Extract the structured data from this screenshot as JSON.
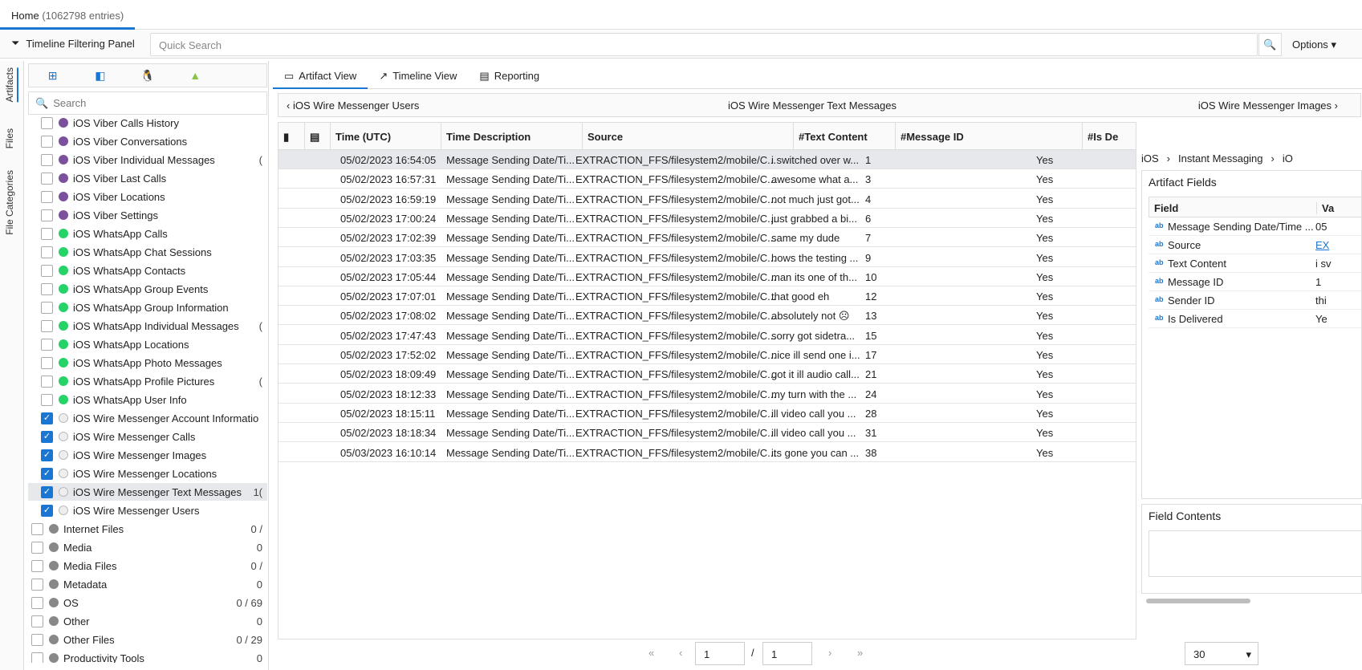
{
  "home": {
    "title": "Home",
    "count": "(1062798 entries)"
  },
  "filterbar": {
    "label": "Timeline Filtering Panel",
    "search_placeholder": "Quick Search",
    "options": "Options"
  },
  "vtabs": {
    "artifacts": "Artifacts",
    "files": "Files",
    "categories": "File Categories"
  },
  "sidebar": {
    "search": "Search",
    "items": [
      {
        "label": "iOS Viber Calls History",
        "icon": "viber",
        "checked": false,
        "sub": true
      },
      {
        "label": "iOS Viber Conversations",
        "icon": "viber",
        "checked": false,
        "sub": true
      },
      {
        "label": "iOS Viber Individual Messages",
        "icon": "viber",
        "checked": false,
        "sub": true,
        "count": "("
      },
      {
        "label": "iOS Viber Last Calls",
        "icon": "viber",
        "checked": false,
        "sub": true
      },
      {
        "label": "iOS Viber Locations",
        "icon": "viber",
        "checked": false,
        "sub": true
      },
      {
        "label": "iOS Viber Settings",
        "icon": "viber",
        "checked": false,
        "sub": true
      },
      {
        "label": "iOS WhatsApp Calls",
        "icon": "wa",
        "checked": false,
        "sub": true
      },
      {
        "label": "iOS WhatsApp Chat Sessions",
        "icon": "wa",
        "checked": false,
        "sub": true
      },
      {
        "label": "iOS WhatsApp Contacts",
        "icon": "wa",
        "checked": false,
        "sub": true
      },
      {
        "label": "iOS WhatsApp Group Events",
        "icon": "wa",
        "checked": false,
        "sub": true
      },
      {
        "label": "iOS WhatsApp Group Information",
        "icon": "wa",
        "checked": false,
        "sub": true
      },
      {
        "label": "iOS WhatsApp Individual Messages",
        "icon": "wa",
        "checked": false,
        "sub": true,
        "count": "("
      },
      {
        "label": "iOS WhatsApp Locations",
        "icon": "wa",
        "checked": false,
        "sub": true
      },
      {
        "label": "iOS WhatsApp Photo Messages",
        "icon": "wa",
        "checked": false,
        "sub": true
      },
      {
        "label": "iOS WhatsApp Profile Pictures",
        "icon": "wa",
        "checked": false,
        "sub": true,
        "count": "("
      },
      {
        "label": "iOS WhatsApp User Info",
        "icon": "wa",
        "checked": false,
        "sub": true
      },
      {
        "label": "iOS Wire Messenger Account Informatio",
        "icon": "wire",
        "checked": true,
        "sub": true
      },
      {
        "label": "iOS Wire Messenger Calls",
        "icon": "wire",
        "checked": true,
        "sub": true
      },
      {
        "label": "iOS Wire Messenger Images",
        "icon": "wire",
        "checked": true,
        "sub": true
      },
      {
        "label": "iOS Wire Messenger Locations",
        "icon": "wire",
        "checked": true,
        "sub": true
      },
      {
        "label": "iOS Wire Messenger Text Messages",
        "icon": "wire",
        "checked": true,
        "sub": true,
        "count": "1(",
        "selected": true
      },
      {
        "label": "iOS Wire Messenger Users",
        "icon": "wire",
        "checked": true,
        "sub": true
      },
      {
        "label": "Internet Files",
        "icon": "cat",
        "checked": false,
        "sub": false,
        "count": "0 /"
      },
      {
        "label": "Media",
        "icon": "cat",
        "checked": false,
        "sub": false,
        "count": "0"
      },
      {
        "label": "Media Files",
        "icon": "cat",
        "checked": false,
        "sub": false,
        "count": "0 /"
      },
      {
        "label": "Metadata",
        "icon": "cat",
        "checked": false,
        "sub": false,
        "count": "0"
      },
      {
        "label": "OS",
        "icon": "cat",
        "checked": false,
        "sub": false,
        "count": "0 / 69"
      },
      {
        "label": "Other",
        "icon": "cat",
        "checked": false,
        "sub": false,
        "count": "0"
      },
      {
        "label": "Other Files",
        "icon": "cat",
        "checked": false,
        "sub": false,
        "count": "0 / 29"
      },
      {
        "label": "Productivity Tools",
        "icon": "cat",
        "checked": false,
        "sub": false,
        "count": "0"
      }
    ]
  },
  "viewtabs": [
    "Artifact View",
    "Timeline View",
    "Reporting"
  ],
  "artnav": {
    "prev": "iOS Wire Messenger Users",
    "current": "iOS Wire Messenger Text Messages",
    "next": "iOS Wire Messenger Images"
  },
  "grid": {
    "headers": [
      "Time (UTC)",
      "Time Description",
      "Source",
      "#Text Content",
      "#Message ID",
      "#Is De"
    ],
    "rows": [
      [
        "05/02/2023 16:54:05",
        "Message Sending Date/Ti...",
        "EXTRACTION_FFS/filesystem2/mobile/C...",
        "i switched over w...",
        "1",
        "Yes"
      ],
      [
        "05/02/2023 16:57:31",
        "Message Sending Date/Ti...",
        "EXTRACTION_FFS/filesystem2/mobile/C...",
        "awesome  what a...",
        "3",
        "Yes"
      ],
      [
        "05/02/2023 16:59:19",
        "Message Sending Date/Ti...",
        "EXTRACTION_FFS/filesystem2/mobile/C...",
        "not much just got...",
        "4",
        "Yes"
      ],
      [
        "05/02/2023 17:00:24",
        "Message Sending Date/Ti...",
        "EXTRACTION_FFS/filesystem2/mobile/C...",
        "just grabbed a bi...",
        "6",
        "Yes"
      ],
      [
        "05/02/2023 17:02:39",
        "Message Sending Date/Ti...",
        "EXTRACTION_FFS/filesystem2/mobile/C...",
        "same my dude",
        "7",
        "Yes"
      ],
      [
        "05/02/2023 17:03:35",
        "Message Sending Date/Ti...",
        "EXTRACTION_FFS/filesystem2/mobile/C...",
        "hows the testing ...",
        "9",
        "Yes"
      ],
      [
        "05/02/2023 17:05:44",
        "Message Sending Date/Ti...",
        "EXTRACTION_FFS/filesystem2/mobile/C...",
        "man its one of th...",
        "10",
        "Yes"
      ],
      [
        "05/02/2023 17:07:01",
        "Message Sending Date/Ti...",
        "EXTRACTION_FFS/filesystem2/mobile/C...",
        "that good eh",
        "12",
        "Yes"
      ],
      [
        "05/02/2023 17:08:02",
        "Message Sending Date/Ti...",
        "EXTRACTION_FFS/filesystem2/mobile/C...",
        "absolutely not ☹",
        "13",
        "Yes"
      ],
      [
        "05/02/2023 17:47:43",
        "Message Sending Date/Ti...",
        "EXTRACTION_FFS/filesystem2/mobile/C...",
        "sorry got sidetra...",
        "15",
        "Yes"
      ],
      [
        "05/02/2023 17:52:02",
        "Message Sending Date/Ti...",
        "EXTRACTION_FFS/filesystem2/mobile/C...",
        "nice ill send one i...",
        "17",
        "Yes"
      ],
      [
        "05/02/2023 18:09:49",
        "Message Sending Date/Ti...",
        "EXTRACTION_FFS/filesystem2/mobile/C...",
        "got it ill audio call...",
        "21",
        "Yes"
      ],
      [
        "05/02/2023 18:12:33",
        "Message Sending Date/Ti...",
        "EXTRACTION_FFS/filesystem2/mobile/C...",
        "my turn with the ...",
        "24",
        "Yes"
      ],
      [
        "05/02/2023 18:15:11",
        "Message Sending Date/Ti...",
        "EXTRACTION_FFS/filesystem2/mobile/C...",
        "ill video call you ...",
        "28",
        "Yes"
      ],
      [
        "05/02/2023 18:18:34",
        "Message Sending Date/Ti...",
        "EXTRACTION_FFS/filesystem2/mobile/C...",
        "ill video call you ...",
        "31",
        "Yes"
      ],
      [
        "05/03/2023 16:10:14",
        "Message Sending Date/Ti...",
        "EXTRACTION_FFS/filesystem2/mobile/C...",
        "its gone you can ...",
        "38",
        "Yes"
      ]
    ]
  },
  "pager": {
    "page": "1",
    "sep": "/",
    "total": "1",
    "pagesize": "30"
  },
  "detail": {
    "crumbs": [
      "iOS",
      "Instant Messaging",
      "iO"
    ],
    "fields_title": "Artifact Fields",
    "col_field": "Field",
    "col_value": "Va",
    "fields": [
      {
        "name": "Message Sending Date/Time ...",
        "value": "05"
      },
      {
        "name": "Source",
        "value": "EX"
      },
      {
        "name": "Text Content",
        "value": "i sv"
      },
      {
        "name": "Message ID",
        "value": "1"
      },
      {
        "name": "Sender ID",
        "value": "thi"
      },
      {
        "name": "Is Delivered",
        "value": "Ye"
      }
    ],
    "contents_title": "Field Contents"
  }
}
